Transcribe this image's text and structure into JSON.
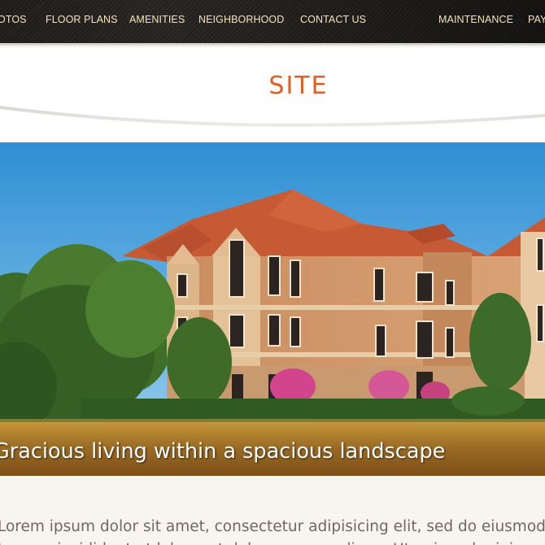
{
  "nav": {
    "items": [
      "OTOS",
      "FLOOR PLANS",
      "AMENITIES",
      "NEIGHBORHOOD",
      "CONTACT US",
      "MAINTENANCE",
      "PAY"
    ]
  },
  "header": {
    "title": "SITE"
  },
  "hero": {
    "caption": "Gracious living within a spacious landscape",
    "image_description_icon": "apartment-building-photo"
  },
  "content": {
    "lines": [
      "Lorem ipsum dolor sit amet, consectetur adipisicing elit, sed do eiusmod",
      "tempor incididunt ut labore et dolore magna aliqua. Ut enim ad minim veniam"
    ]
  },
  "colors": {
    "nav_text": "#f3e3bd",
    "title_accent": "#e65a23",
    "page_bg": "#f8f5ee",
    "body_text": "#6e6862"
  }
}
